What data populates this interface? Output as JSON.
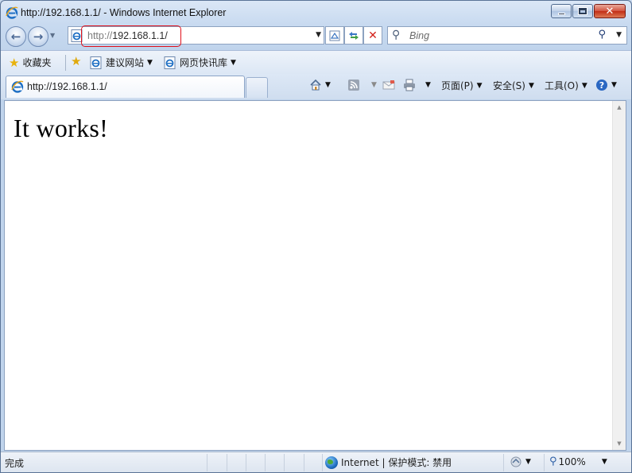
{
  "window": {
    "title": "http://192.168.1.1/ - Windows Internet Explorer"
  },
  "address_bar": {
    "url_scheme": "http://",
    "url_rest": "192.168.1.1/"
  },
  "search": {
    "placeholder": "Bing"
  },
  "favorites_bar": {
    "favorites_label": "收藏夹",
    "items": [
      {
        "label": "建议网站",
        "icon": "ie-page-icon"
      },
      {
        "label": "网页快讯库",
        "icon": "ie-page-icon"
      }
    ]
  },
  "tab": {
    "label": "http://192.168.1.1/"
  },
  "command_bar": {
    "page_label": "页面(P)",
    "safety_label": "安全(S)",
    "tools_label": "工具(O)"
  },
  "page": {
    "body_text": "It works!"
  },
  "status_bar": {
    "status_text": "完成",
    "zone_text": "Internet | 保护模式: 禁用",
    "zoom": "100%"
  },
  "colors": {
    "highlight": "#e0101a",
    "ie_blue": "#1e6fc4"
  }
}
